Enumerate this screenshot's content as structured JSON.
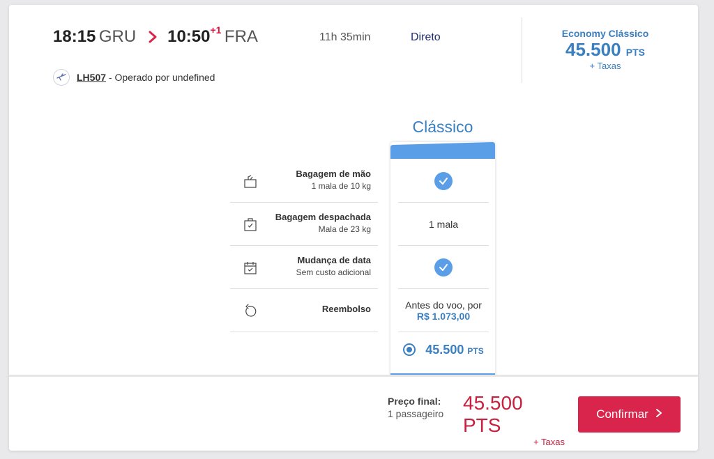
{
  "flight": {
    "depart_time": "18:15",
    "depart_airport": "GRU",
    "arrive_time": "10:50",
    "day_offset": "+1",
    "arrive_airport": "FRA",
    "duration": "11h 35min",
    "stops": "Direto",
    "flight_number": "LH507",
    "operated_by": " - Operado por undefined"
  },
  "fare_summary": {
    "class_name": "Economy Clássico",
    "price": "45.500",
    "unit": "PTS",
    "taxes": "+ Taxas"
  },
  "fare_column": {
    "title": "Clássico",
    "header_color": "#5b9ee8",
    "price": "45.500",
    "unit": "PTS"
  },
  "features": [
    {
      "title": "Bagagem de mão",
      "subtitle": "1 mala de 10 kg",
      "icon": "hand-bag-icon",
      "value_type": "check"
    },
    {
      "title": "Bagagem despachada",
      "subtitle": "Mala de 23 kg",
      "icon": "checked-bag-icon",
      "value": "1 mala"
    },
    {
      "title": "Mudança de data",
      "subtitle": "Sem custo adicional",
      "icon": "calendar-icon",
      "value_type": "check"
    },
    {
      "title": "Reembolso",
      "subtitle": "",
      "icon": "refund-icon",
      "value": "Antes do voo, por",
      "value_strong": "R$ 1.073,00"
    }
  ],
  "footer": {
    "label": "Preço final:",
    "passengers": "1 passageiro",
    "price": "45.500 PTS",
    "taxes": "+ Taxas",
    "confirm_label": "Confirmar"
  },
  "colors": {
    "accent_blue": "#3a7fc0",
    "brand_red": "#d9244b",
    "nav_blue": "#1f2d73"
  }
}
